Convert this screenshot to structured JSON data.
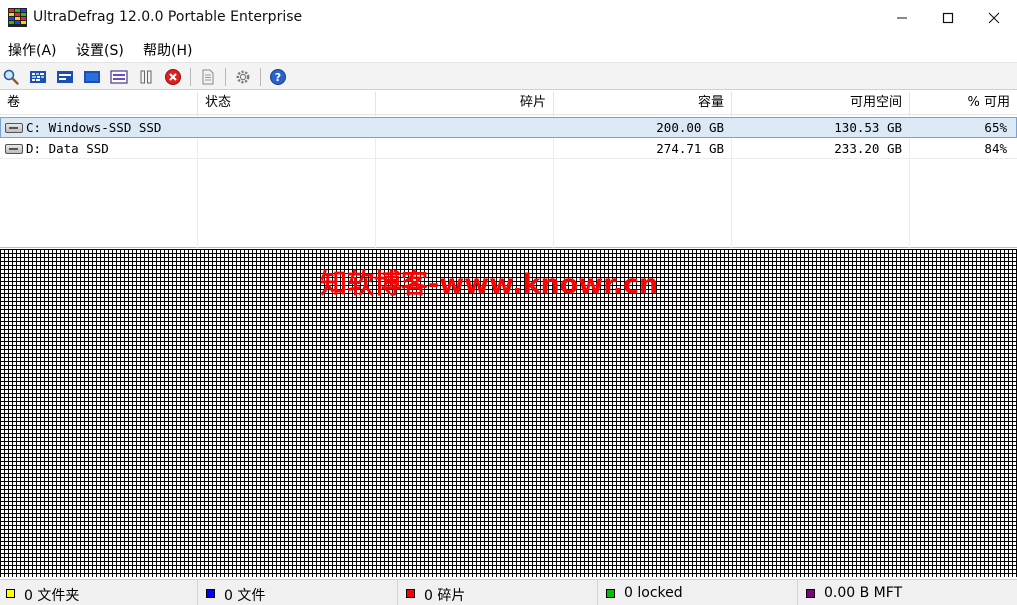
{
  "window": {
    "title": "UltraDefrag 12.0.0 Portable Enterprise"
  },
  "menu": [
    {
      "label": "操作(A)"
    },
    {
      "label": "设置(S)"
    },
    {
      "label": "帮助(H)"
    }
  ],
  "toolbar": [
    {
      "name": "analyze-icon"
    },
    {
      "name": "defrag-icon"
    },
    {
      "name": "quick-optimize-icon"
    },
    {
      "name": "full-optimize-icon"
    },
    {
      "name": "mft-optimize-icon"
    },
    {
      "name": "pause-icon"
    },
    {
      "name": "stop-icon"
    },
    {
      "name": "report-icon"
    },
    {
      "name": "settings-icon"
    },
    {
      "name": "help-icon"
    }
  ],
  "list": {
    "columns": [
      {
        "label": "卷"
      },
      {
        "label": "状态"
      },
      {
        "label": "碎片"
      },
      {
        "label": "容量"
      },
      {
        "label": "可用空间"
      },
      {
        "label": "% 可用"
      }
    ],
    "rows": [
      {
        "volume": "C: Windows-SSD SSD",
        "status": "",
        "fragments": "",
        "capacity": "200.00 GB",
        "free": "130.53 GB",
        "percent": "65%",
        "selected": true
      },
      {
        "volume": "D: Data SSD",
        "status": "",
        "fragments": "",
        "capacity": "274.71 GB",
        "free": "233.20 GB",
        "percent": "84%",
        "selected": false
      }
    ]
  },
  "watermark": "知软博客-www.knowr.cn",
  "status": [
    {
      "color": "#ffff00",
      "text": "0 文件夹"
    },
    {
      "color": "#0000ff",
      "text": "0 文件"
    },
    {
      "color": "#ff0000",
      "text": "0 碎片"
    },
    {
      "color": "#00c000",
      "text": "0 locked"
    },
    {
      "color": "#800080",
      "text": "0.00 B MFT"
    }
  ]
}
